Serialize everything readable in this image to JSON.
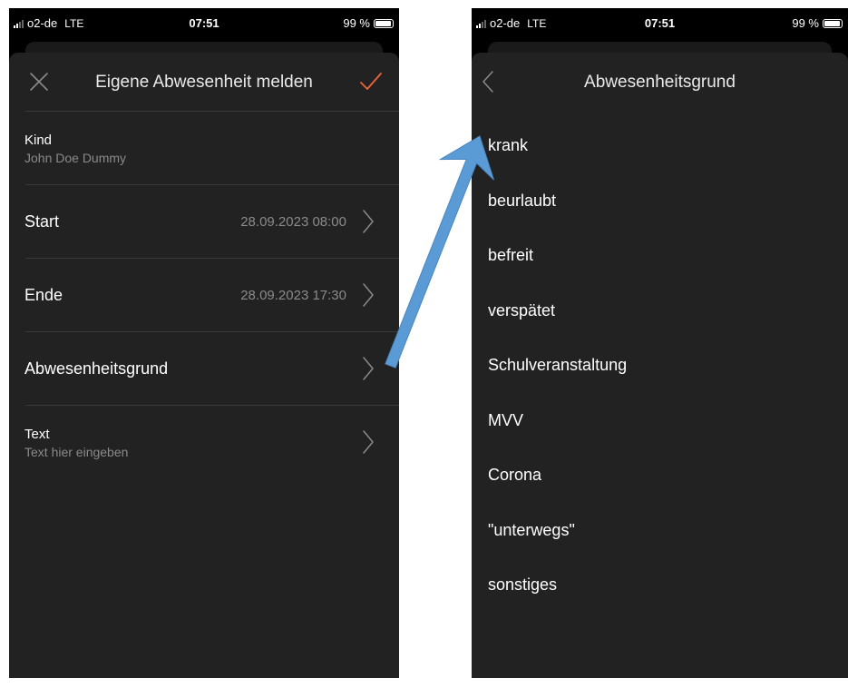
{
  "status_bar": {
    "carrier": "o2-de",
    "network": "LTE",
    "time": "07:51",
    "battery": "99 %"
  },
  "left_screen": {
    "title": "Eigene Abwesenheit melden",
    "icons": {
      "close": "close-icon",
      "confirm": "checkmark-icon",
      "row_disclosure": "chevron-right-icon"
    },
    "kind": {
      "label": "Kind",
      "value": "John Doe Dummy"
    },
    "start": {
      "label": "Start",
      "value": "28.09.2023 08:00"
    },
    "end": {
      "label": "Ende",
      "value": "28.09.2023 17:30"
    },
    "reason": {
      "label": "Abwesenheitsgrund"
    },
    "text": {
      "label": "Text",
      "placeholder": "Text hier eingeben"
    }
  },
  "right_screen": {
    "title": "Abwesenheitsgrund",
    "icons": {
      "back": "chevron-left-icon"
    },
    "options": [
      "krank",
      "beurlaubt",
      "befreit",
      "verspätet",
      "Schulveranstaltung",
      "MVV",
      "Corona",
      "\"unterwegs\"",
      "sonstiges"
    ]
  },
  "colors": {
    "accent": "#e8633a",
    "sheet_background": "#222222",
    "secondary_text": "#8a8a8a",
    "arrow": "#5b9bd5"
  }
}
